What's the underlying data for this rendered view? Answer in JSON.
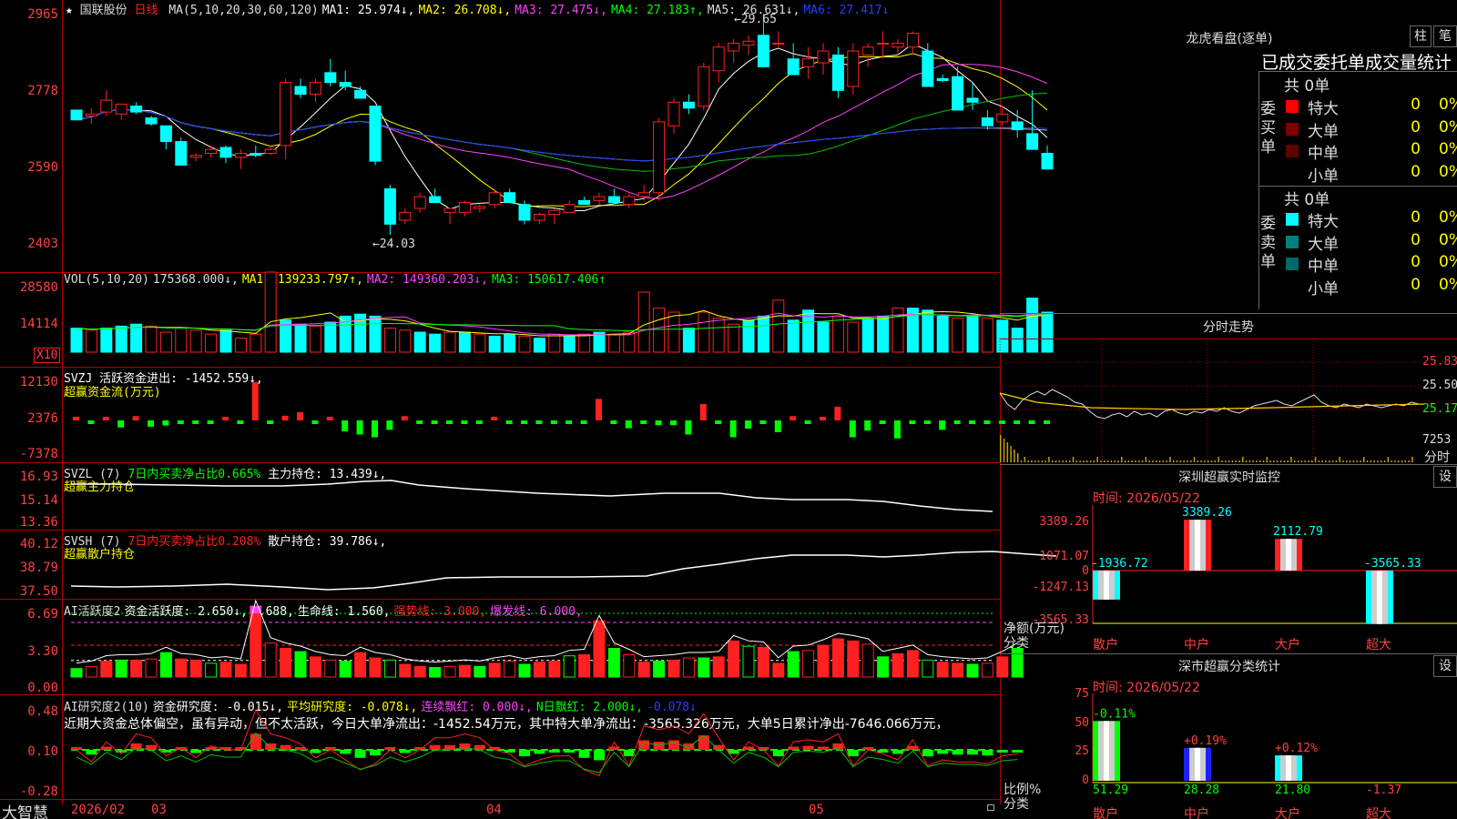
{
  "stock": {
    "star": "★",
    "name": "国联股份",
    "period": "日线"
  },
  "ma_legend": [
    {
      "text": "MA(5,10,20,30,60,120)",
      "color": "#dddddd"
    },
    {
      "text": "MA1: 25.974↓,",
      "color": "#ffffff"
    },
    {
      "text": "MA2: 26.708↓,",
      "color": "#ffff00"
    },
    {
      "text": "MA3: 27.475↓,",
      "color": "#ff40ff"
    },
    {
      "text": "MA4: 27.183↑,",
      "color": "#00ff00"
    },
    {
      "text": "MA5: 26.631↓,",
      "color": "#dddddd"
    },
    {
      "text": "MA6: 27.417↓",
      "color": "#2040ff"
    }
  ],
  "price_axis": [
    "2965",
    "2778",
    "2590",
    "2403"
  ],
  "price_annotations": {
    "high": "29.65",
    "low": "24.03"
  },
  "vol_legend": [
    {
      "text": "VOL(5,10,20)",
      "color": "#dddddd"
    },
    {
      "text": "175368.000↓,",
      "color": "#dddddd"
    },
    {
      "text": "MA1: 139233.797↑,",
      "color": "#ffff00"
    },
    {
      "text": "MA2: 149360.203↓,",
      "color": "#ff40ff"
    },
    {
      "text": "MA3: 150617.406↑",
      "color": "#00ff00"
    }
  ],
  "vol_axis": [
    "28580",
    "14114"
  ],
  "vol_unit": "X10",
  "svzj": {
    "legend1": "SVZJ  活跃资金进出: -1452.559↓,",
    "legend2": "超赢资金流(万元)",
    "axis": [
      "12130",
      "2376",
      "-7378"
    ]
  },
  "svzl": {
    "legend_name": "SVZL (7)",
    "legend_ratio": "7日内买卖净占比0.665%",
    "legend_hold": "主力持仓: 13.439↓,",
    "legend2": "超赢主力持仓",
    "axis": [
      "16.93",
      "15.14",
      "13.36"
    ]
  },
  "svsh": {
    "legend_name": "SVSH (7)",
    "legend_ratio": "7日内买卖净占比0.208%",
    "legend_hold": "散户持仓: 39.786↓,",
    "legend2": "超赢散户持仓",
    "axis": [
      "40.12",
      "38.79",
      "37.50"
    ]
  },
  "ai_active": {
    "legend": [
      {
        "text": "AI活跃度2",
        "color": "#dddddd"
      },
      {
        "text": "资金活跃度: 2.650↓,",
        "color": "#ffffff"
      },
      {
        "text": "6.688,",
        "color": "#ffffff"
      },
      {
        "text": "生命线: 1.560,",
        "color": "#ffffff"
      },
      {
        "text": "强势线: 3.000,",
        "color": "#ff2020"
      },
      {
        "text": "爆发线: 6.000,",
        "color": "#ff40ff"
      }
    ],
    "axis": [
      "6.69",
      "3.30",
      "0.00"
    ]
  },
  "ai_research": {
    "legend": [
      {
        "text": "AI研究度2(10)",
        "color": "#dddddd"
      },
      {
        "text": "资金研究度: -0.015↓,",
        "color": "#ffffff"
      },
      {
        "text": "平均研究度: -0.078↓,",
        "color": "#ffff00"
      },
      {
        "text": "连续飘红: 0.000↓,",
        "color": "#ff40ff"
      },
      {
        "text": "N日飘红: 2.000↓,",
        "color": "#00ff00"
      },
      {
        "text": "-0.078↓",
        "color": "#2040ff"
      }
    ],
    "comment": "近期大资金总体偏空，虽有异动，但不太活跃，今日大单净流出：-1452.54万元，其中特大单净流出：-3565.326万元，大单5日累计净出-7646.066万元，",
    "axis": [
      "0.48",
      "0.10",
      "-0.28"
    ]
  },
  "bottom_bar": {
    "brand": "大智慧",
    "dates": [
      "2026/02",
      "03",
      "04",
      "05"
    ]
  },
  "dragon_tiger": {
    "title": "龙虎看盘(逐单)",
    "btn_zhu": "柱",
    "btn_bi": "笔",
    "tabs": "已成交委托单成交量统计"
  },
  "order_book": {
    "buy": {
      "label": "委买单",
      "total": "共 0单",
      "rows": [
        {
          "name": "特大",
          "count": "0",
          "pct": "0%",
          "color": "#ff0000"
        },
        {
          "name": "大单",
          "count": "0",
          "pct": "0%",
          "color": "#800000"
        },
        {
          "name": "中单",
          "count": "0",
          "pct": "0%",
          "color": "#600000"
        },
        {
          "name": "小单",
          "count": "0",
          "pct": "0%",
          "color": "#000000"
        }
      ]
    },
    "sell": {
      "label": "委卖单",
      "total": "共 0单",
      "rows": [
        {
          "name": "特大",
          "count": "0",
          "pct": "0%",
          "color": "#00ffff"
        },
        {
          "name": "大单",
          "count": "0",
          "pct": "0%",
          "color": "#008080"
        },
        {
          "name": "中单",
          "count": "0",
          "pct": "0%",
          "color": "#006868"
        },
        {
          "name": "小单",
          "count": "0",
          "pct": "0%",
          "color": "#000000"
        }
      ]
    }
  },
  "intraday": {
    "title": "分时走势",
    "axis": [
      "25.83",
      "25.50",
      "25.17",
      "7253"
    ],
    "vol_label": "分时"
  },
  "sz_monitor": {
    "title": "深圳超赢实时监控",
    "btn": "设",
    "time": "时间: 2026/05/22",
    "axis": [
      "3389.26",
      "1071.07",
      "0",
      "-1247.13",
      "-3565.33"
    ],
    "ylabel": "净额(万元)",
    "xlabel": "分类",
    "categories": [
      "散户",
      "中户",
      "大户",
      "超大"
    ],
    "values": [
      -1936.72,
      3389.26,
      2112.79,
      -3565.33
    ],
    "value_labels": [
      "-1936.72",
      "3389.26",
      "2112.79",
      "-3565.33"
    ]
  },
  "sz_class": {
    "title": "深市超赢分类统计",
    "btn": "设",
    "time": "时间: 2026/05/22",
    "axis": [
      "75",
      "50",
      "25",
      "0"
    ],
    "ylabel": "比例%",
    "xlabel": "分类",
    "categories": [
      "散户",
      "中户",
      "大户",
      "超大"
    ],
    "values": [
      51.29,
      28.28,
      21.8,
      -1.37
    ],
    "value_labels": [
      "51.29",
      "28.28",
      "21.80",
      "-1.37"
    ],
    "changes": [
      "-0.11%",
      "+0.19%",
      "+0.12%",
      ""
    ]
  },
  "chart_data": {
    "type": "candlestick",
    "candles_ohlc": [
      [
        27.2,
        27.2,
        27.0,
        26.95
      ],
      [
        27.05,
        27.25,
        26.85,
        27.1
      ],
      [
        27.15,
        27.7,
        27.05,
        27.45
      ],
      [
        27.1,
        27.3,
        26.95,
        27.35
      ],
      [
        27.3,
        27.4,
        27.1,
        27.15
      ],
      [
        27.0,
        27.05,
        26.8,
        26.85
      ],
      [
        26.8,
        26.8,
        26.2,
        26.4
      ],
      [
        26.4,
        26.5,
        25.95,
        25.8
      ],
      [
        26.0,
        26.1,
        25.9,
        26.05
      ],
      [
        26.1,
        26.3,
        26.0,
        26.2
      ],
      [
        26.25,
        26.3,
        25.85,
        26.0
      ],
      [
        26.0,
        26.2,
        25.7,
        26.1
      ],
      [
        26.1,
        26.3,
        26.0,
        26.05
      ],
      [
        26.1,
        26.3,
        26.05,
        26.2
      ],
      [
        26.3,
        28.0,
        25.95,
        27.9
      ],
      [
        27.8,
        28.0,
        27.5,
        27.6
      ],
      [
        27.6,
        28.0,
        27.4,
        27.9
      ],
      [
        28.15,
        28.5,
        27.8,
        27.9
      ],
      [
        27.9,
        28.2,
        27.7,
        27.8
      ],
      [
        27.7,
        27.8,
        27.5,
        27.5
      ],
      [
        27.3,
        27.3,
        25.8,
        25.9
      ],
      [
        25.2,
        25.3,
        24.03,
        24.3
      ],
      [
        24.4,
        24.7,
        24.3,
        24.6
      ],
      [
        24.7,
        25.1,
        24.6,
        25.0
      ],
      [
        25.0,
        25.2,
        24.9,
        24.85
      ],
      [
        24.6,
        24.7,
        24.3,
        24.7
      ],
      [
        24.6,
        24.9,
        24.5,
        24.85
      ],
      [
        24.7,
        24.8,
        24.6,
        24.75
      ],
      [
        24.8,
        25.2,
        24.7,
        25.1
      ],
      [
        25.1,
        25.2,
        24.9,
        24.85
      ],
      [
        24.8,
        24.9,
        24.3,
        24.4
      ],
      [
        24.4,
        24.6,
        24.3,
        24.55
      ],
      [
        24.55,
        24.7,
        24.3,
        24.65
      ],
      [
        24.6,
        24.9,
        24.6,
        24.8
      ],
      [
        24.9,
        25.0,
        24.9,
        24.8
      ],
      [
        24.9,
        25.1,
        24.8,
        25.0
      ],
      [
        25.0,
        25.2,
        24.9,
        24.85
      ],
      [
        24.8,
        25.1,
        24.7,
        25.0
      ],
      [
        25.0,
        25.3,
        24.9,
        25.1
      ],
      [
        25.1,
        27.0,
        24.9,
        26.9
      ],
      [
        26.8,
        27.5,
        26.6,
        27.4
      ],
      [
        27.4,
        27.6,
        27.1,
        27.25
      ],
      [
        27.3,
        28.4,
        27.2,
        28.3
      ],
      [
        28.2,
        28.9,
        27.9,
        28.8
      ],
      [
        28.7,
        29.0,
        28.4,
        28.9
      ],
      [
        28.85,
        29.1,
        28.6,
        28.95
      ],
      [
        29.1,
        29.65,
        28.3,
        28.3
      ],
      [
        28.9,
        29.2,
        28.8,
        28.9
      ],
      [
        28.5,
        28.9,
        28.2,
        28.1
      ],
      [
        28.3,
        28.8,
        28.0,
        28.5
      ],
      [
        28.4,
        28.9,
        28.1,
        28.7
      ],
      [
        28.6,
        28.8,
        27.5,
        27.7
      ],
      [
        27.8,
        28.9,
        27.6,
        28.7
      ],
      [
        28.6,
        28.9,
        28.3,
        28.8
      ],
      [
        28.9,
        29.2,
        28.5,
        28.9
      ],
      [
        28.8,
        29.0,
        28.6,
        28.9
      ],
      [
        28.8,
        29.2,
        28.6,
        29.15
      ],
      [
        28.7,
        28.9,
        27.8,
        27.8
      ],
      [
        28.0,
        28.1,
        27.9,
        27.95
      ],
      [
        28.05,
        28.3,
        27.3,
        27.2
      ],
      [
        27.5,
        27.9,
        27.2,
        27.4
      ],
      [
        27.0,
        27.2,
        26.7,
        26.8
      ],
      [
        26.9,
        27.3,
        26.8,
        27.1
      ],
      [
        26.9,
        27.2,
        26.5,
        26.7
      ],
      [
        26.6,
        27.7,
        26.4,
        26.2
      ],
      [
        26.1,
        26.3,
        25.7,
        25.7
      ]
    ],
    "volume_bars": [
      [
        1,
        0.6
      ],
      [
        0,
        0.55
      ],
      [
        1,
        0.6
      ],
      [
        1,
        0.65
      ],
      [
        1,
        0.7
      ],
      [
        0,
        0.65
      ],
      [
        0,
        0.5
      ],
      [
        0,
        0.6
      ],
      [
        0,
        0.55
      ],
      [
        0,
        0.45
      ],
      [
        1,
        0.55
      ],
      [
        0,
        0.35
      ],
      [
        0,
        0.45
      ],
      [
        0,
        2.0
      ],
      [
        1,
        0.8
      ],
      [
        1,
        0.7
      ],
      [
        0,
        0.65
      ],
      [
        1,
        0.75
      ],
      [
        1,
        0.9
      ],
      [
        1,
        0.95
      ],
      [
        1,
        0.9
      ],
      [
        0,
        0.6
      ],
      [
        0,
        0.55
      ],
      [
        1,
        0.5
      ],
      [
        1,
        0.45
      ],
      [
        0,
        0.5
      ],
      [
        1,
        0.5
      ],
      [
        0,
        0.45
      ],
      [
        1,
        0.4
      ],
      [
        1,
        0.45
      ],
      [
        0,
        0.4
      ],
      [
        1,
        0.35
      ],
      [
        0,
        0.45
      ],
      [
        1,
        0.4
      ],
      [
        0,
        0.45
      ],
      [
        1,
        0.5
      ],
      [
        0,
        0.45
      ],
      [
        0,
        0.5
      ],
      [
        0,
        1.5
      ],
      [
        0,
        1.1
      ],
      [
        0,
        1.0
      ],
      [
        1,
        0.6
      ],
      [
        0,
        1.0
      ],
      [
        0,
        0.85
      ],
      [
        0,
        0.7
      ],
      [
        1,
        0.8
      ],
      [
        1,
        0.9
      ],
      [
        0,
        1.3
      ],
      [
        1,
        0.8
      ],
      [
        1,
        1.05
      ],
      [
        1,
        0.75
      ],
      [
        0,
        0.9
      ],
      [
        0,
        0.75
      ],
      [
        1,
        0.85
      ],
      [
        1,
        0.9
      ],
      [
        0,
        1.1
      ],
      [
        1,
        1.1
      ],
      [
        1,
        1.05
      ],
      [
        1,
        0.9
      ],
      [
        0,
        0.85
      ],
      [
        1,
        0.9
      ],
      [
        0,
        0.85
      ],
      [
        1,
        0.8
      ],
      [
        1,
        0.6
      ],
      [
        1,
        1.35
      ],
      [
        1,
        1.0
      ]
    ],
    "capital_flow": [
      0.5,
      -0.3,
      0.4,
      -1.8,
      1.1,
      -1.6,
      -1.3,
      -0.9,
      -0.2,
      -0.3,
      0.6,
      -0.3,
      9.8,
      -0.6,
      1.2,
      2.1,
      -0.3,
      0.2,
      -2.8,
      -3.6,
      -4.3,
      -2.4,
      1.1,
      -0.3,
      -0.7,
      -0.5,
      -0.7,
      -0.6,
      0.6,
      -0.4,
      -0.5,
      -0.3,
      -0.3,
      -0.3,
      -0.6,
      5.5,
      -0.3,
      -2.0,
      -0.4,
      -1.2,
      -1.2,
      -3.6,
      4.2,
      -0.4,
      -4.3,
      -2.1,
      -0.9,
      -3.0,
      1.1,
      -0.6,
      0.5,
      3.5,
      -4.3,
      -2.6,
      -0.9,
      -4.6,
      -0.4,
      -0.5,
      -2.4,
      -0.4,
      -0.9,
      -0.6,
      -0.5,
      -0.5,
      -0.3,
      -0.4
    ],
    "active": [
      0.8,
      1.0,
      1.5,
      1.6,
      1.6,
      1.7,
      2.3,
      1.7,
      1.6,
      1.3,
      1.4,
      1.2,
      6.69,
      3.2,
      2.7,
      2.4,
      1.9,
      1.6,
      1.5,
      2.3,
      1.8,
      1.6,
      1.2,
      1.0,
      0.9,
      1.0,
      1.1,
      1.0,
      1.3,
      1.5,
      1.2,
      1.4,
      1.5,
      2.0,
      2.1,
      5.3,
      2.7,
      2.1,
      1.4,
      1.5,
      1.6,
      1.8,
      1.8,
      1.9,
      3.4,
      2.9,
      2.8,
      1.3,
      2.4,
      2.5,
      3.0,
      3.6,
      3.4,
      3.1,
      1.9,
      2.2,
      2.5,
      1.6,
      1.4,
      1.3,
      1.2,
      1.3,
      1.9,
      2.7
    ],
    "research": [
      0.0,
      -0.06,
      0.04,
      -0.02,
      0.08,
      0.06,
      -0.03,
      0.01,
      -0.04,
      0.02,
      0.0,
      0.0,
      0.2,
      0.08,
      0.06,
      0.03,
      -0.04,
      0.0,
      -0.05,
      -0.1,
      -0.07,
      0.0,
      -0.04,
      0.0,
      0.06,
      0.06,
      0.08,
      0.06,
      0.0,
      -0.02,
      -0.08,
      -0.05,
      -0.03,
      -0.03,
      -0.1,
      -0.13,
      0.04,
      -0.08,
      0.12,
      0.1,
      0.12,
      0.08,
      0.18,
      0.06,
      -0.05,
      0.04,
      0.0,
      -0.08,
      0.04,
      0.05,
      0.04,
      0.08,
      -0.08,
      0.0,
      -0.02,
      -0.05,
      0.05,
      -0.08,
      -0.05,
      -0.06,
      -0.06,
      -0.07,
      -0.03,
      -0.02
    ]
  }
}
